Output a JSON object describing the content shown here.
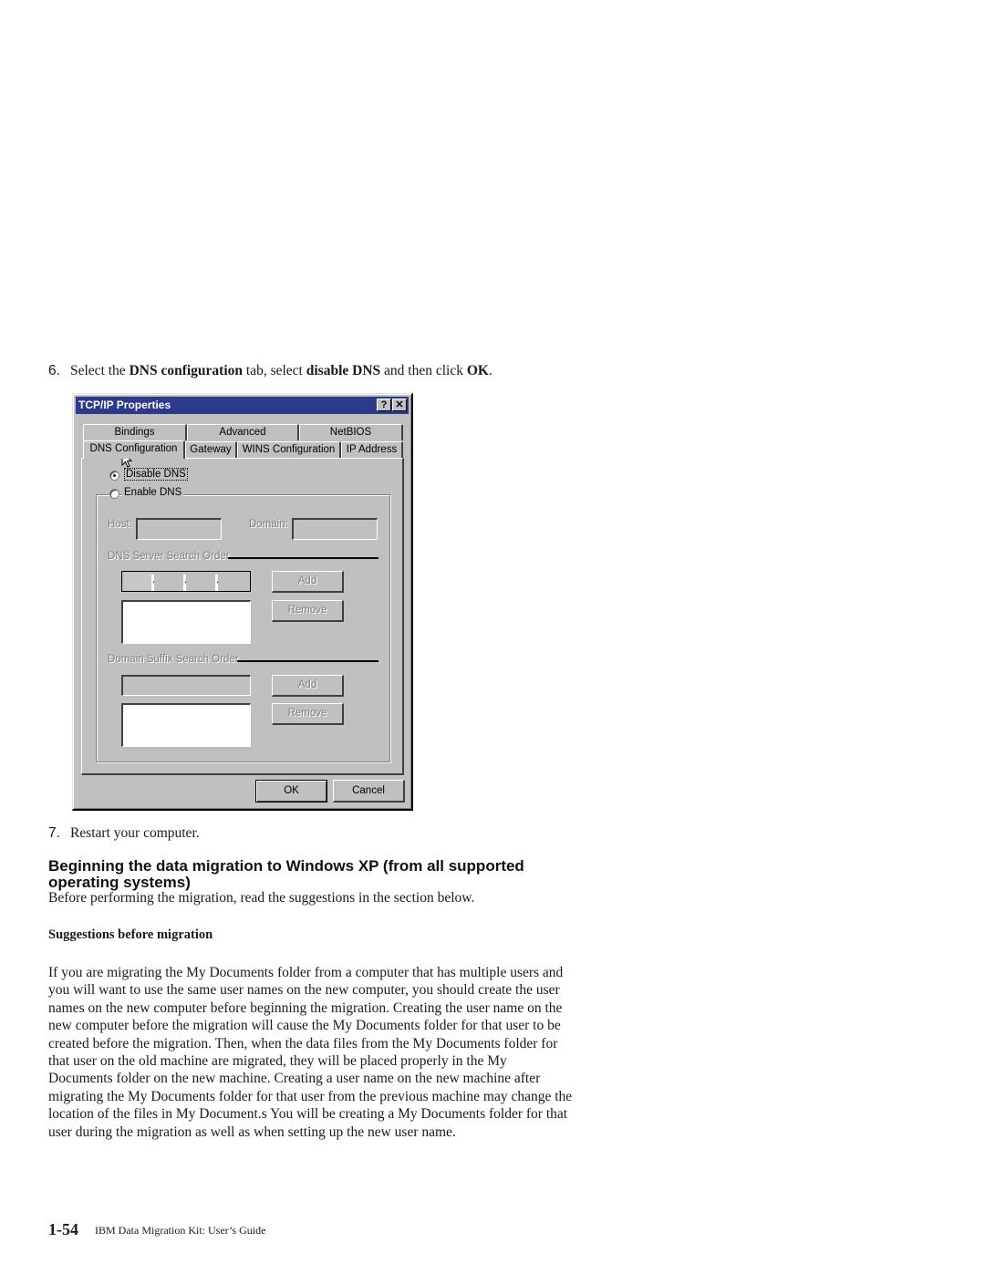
{
  "steps": {
    "step6": {
      "number": "6.",
      "parts": [
        {
          "text": "Select the ",
          "bold": false
        },
        {
          "text": "DNS configuration",
          "bold": true
        },
        {
          "text": " tab, select ",
          "bold": false
        },
        {
          "text": "disable DNS",
          "bold": true
        },
        {
          "text": " and then click ",
          "bold": false
        },
        {
          "text": "OK",
          "bold": true
        },
        {
          "text": ".",
          "bold": false
        }
      ]
    },
    "step7": {
      "number": "7.",
      "text": "Restart your computer."
    }
  },
  "dialog": {
    "title": "TCP/IP Properties",
    "help_button": "?",
    "close_button": "✕",
    "tabs_back_row": [
      "Bindings",
      "Advanced",
      "NetBIOS"
    ],
    "tabs_front_row": [
      "DNS Configuration",
      "Gateway",
      "WINS Configuration",
      "IP Address"
    ],
    "active_tab": "DNS Configuration",
    "disable_dns": {
      "label": "Disable DNS",
      "selected": true
    },
    "enable_dns": {
      "label": "Enable DNS",
      "selected": false
    },
    "host_label": "Host:",
    "host_value": "",
    "domain_label": "Domain:",
    "domain_value": "",
    "dns_server_order_label": "DNS Server Search Order",
    "ip_separator": ".",
    "add_label": "Add",
    "remove_label": "Remove",
    "domain_suffix_order_label": "Domain Suffix Search Order",
    "ok_label": "OK",
    "cancel_label": "Cancel"
  },
  "section": {
    "heading": "Beginning the data migration to Windows XP (from all supported operating systems)",
    "intro": "Before performing the migration, read the suggestions in the section below.",
    "subheading": "Suggestions before migration",
    "body": "If you are migrating the My Documents folder from a computer that has multiple users and you will want to use the same user names on the new computer, you should create the user names on the new computer before beginning the migration. Creating the user name on the new computer before the migration will cause the My Documents folder for that user to be created before the migration. Then, when the data files from the My Documents folder for that user on the old machine are migrated, they will be placed properly in the My Documents folder on the new machine. Creating a user name on the new machine after migrating the My Documents folder for that user from the previous machine may change the location of the files in My Document.s You will be creating a My Documents folder for that user during the migration as well as when setting up the new user name."
  },
  "footer": {
    "page_number": "1-54",
    "book_title": "IBM Data Migration Kit:  User’s Guide"
  }
}
